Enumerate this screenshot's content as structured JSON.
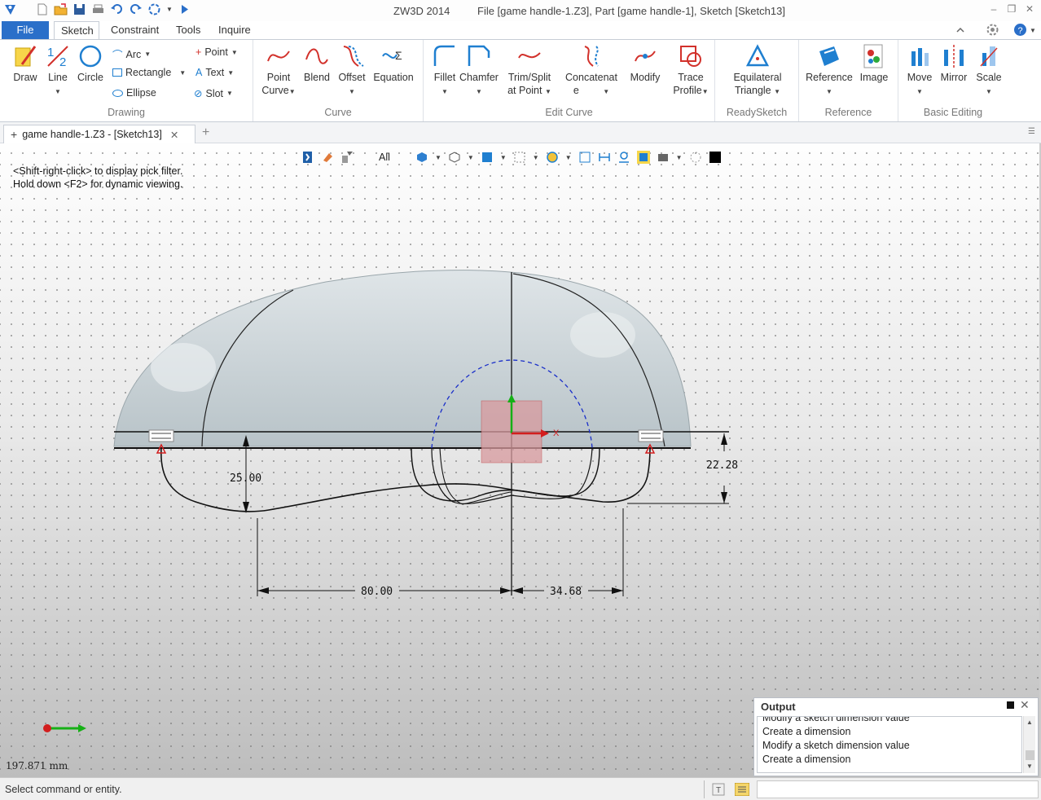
{
  "window": {
    "app_title": "ZW3D 2014",
    "doc_title": "File [game handle-1.Z3],  Part [game handle-1],  Sketch [Sketch13]"
  },
  "ribbon_tabs": [
    "File",
    "Sketch",
    "Constraint",
    "Tools",
    "Inquire"
  ],
  "ribbon": {
    "drawing": {
      "label": "Drawing",
      "draw": "Draw",
      "line": "Line",
      "circle": "Circle",
      "arc": "Arc",
      "rectangle": "Rectangle",
      "ellipse": "Ellipse",
      "point": "Point",
      "text": "Text",
      "slot": "Slot"
    },
    "curve": {
      "label": "Curve",
      "point_curve_1": "Point",
      "point_curve_2": "Curve",
      "blend": "Blend",
      "offset": "Offset",
      "equation": "Equation"
    },
    "edit_curve": {
      "label": "Edit Curve",
      "fillet": "Fillet",
      "chamfer": "Chamfer",
      "trim_1": "Trim/Split",
      "trim_2": "at Point",
      "concat_1": "Concatenat",
      "concat_2": "e",
      "modify": "Modify",
      "trace_1": "Trace",
      "trace_2": "Profile"
    },
    "readysketch": {
      "label": "ReadySketch",
      "eq_1": "Equilateral",
      "eq_2": "Triangle"
    },
    "reference": {
      "label": "Reference",
      "reference": "Reference",
      "image": "Image"
    },
    "basic_editing": {
      "label": "Basic Editing",
      "move": "Move",
      "mirror": "Mirror",
      "scale": "Scale"
    }
  },
  "doc_tab": {
    "title": "game handle-1.Z3 - [Sketch13]"
  },
  "viewport": {
    "filter_label": "All",
    "hint_line1": "<Shift-right-click> to display pick filter.",
    "hint_line2": "Hold down <F2> for dynamic viewing.",
    "coord_readout": "197.871  mm",
    "dimensions": {
      "d1": "25.00",
      "d2": "22.28",
      "d3": "80.00",
      "d4": "34.68"
    },
    "axis_x_label": "X"
  },
  "output": {
    "title": "Output",
    "lines": [
      "Modify a sketch dimension value",
      "Create a dimension",
      "Modify a sketch dimension value",
      "Create a dimension"
    ]
  },
  "status": {
    "text": "Select command or entity."
  },
  "colors": {
    "accent": "#2a6fc9",
    "icon_red": "#d2312b",
    "icon_blue": "#1f7fd0"
  }
}
